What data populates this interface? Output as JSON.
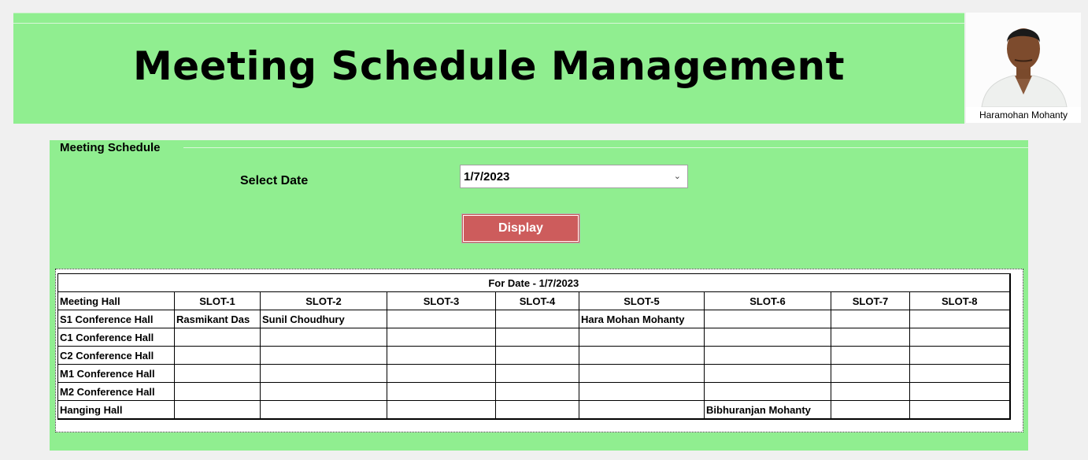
{
  "header": {
    "title": "Meeting Schedule Management"
  },
  "user": {
    "name": "Haramohan Mohanty"
  },
  "panel": {
    "title": "Meeting Schedule",
    "select_date_label": "Select Date",
    "date_value": "1/7/2023",
    "display_button": "Display"
  },
  "schedule": {
    "caption": "For Date - 1/7/2023",
    "hall_header": "Meeting Hall",
    "slots": [
      "SLOT-1",
      "SLOT-2",
      "SLOT-3",
      "SLOT-4",
      "SLOT-5",
      "SLOT-6",
      "SLOT-7",
      "SLOT-8"
    ],
    "rows": [
      {
        "hall": "S1 Conference Hall",
        "cells": [
          "Rasmikant Das",
          "Sunil Choudhury",
          "",
          "",
          "Hara Mohan Mohanty",
          "",
          "",
          ""
        ]
      },
      {
        "hall": "C1 Conference Hall",
        "cells": [
          "",
          "",
          "",
          "",
          "",
          "",
          "",
          ""
        ]
      },
      {
        "hall": "C2 Conference Hall",
        "cells": [
          "",
          "",
          "",
          "",
          "",
          "",
          "",
          ""
        ]
      },
      {
        "hall": "M1 Conference Hall",
        "cells": [
          "",
          "",
          "",
          "",
          "",
          "",
          "",
          ""
        ]
      },
      {
        "hall": "M2 Conference Hall",
        "cells": [
          "",
          "",
          "",
          "",
          "",
          "",
          "",
          ""
        ]
      },
      {
        "hall": "Hanging Hall",
        "cells": [
          "",
          "",
          "",
          "",
          "",
          "Bibhuranjan Mohanty",
          "",
          ""
        ]
      }
    ]
  },
  "colors": {
    "panel_green": "#90ee90",
    "button_red": "#cd5c5c"
  }
}
